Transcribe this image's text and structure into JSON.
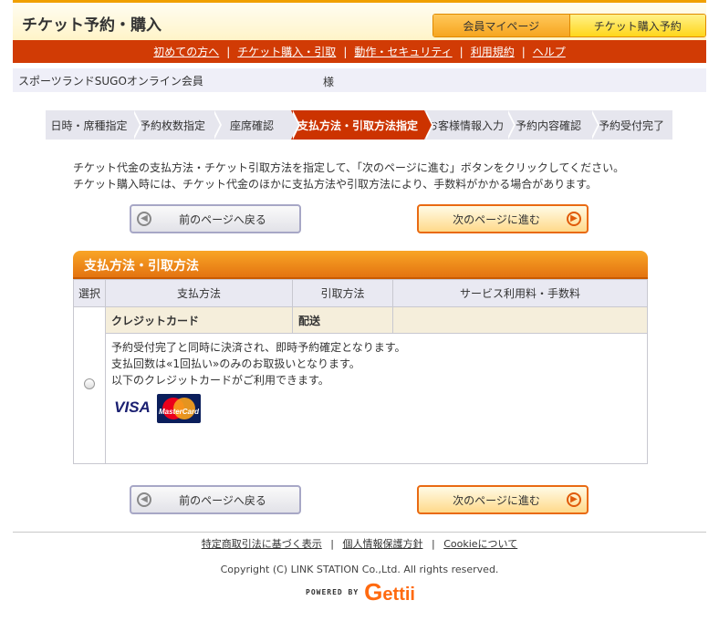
{
  "header": {
    "site_title": "チケット予約・購入",
    "tab_mypage": "会員マイページ",
    "tab_buy": "チケット購入予約"
  },
  "nav": {
    "items": [
      "初めての方へ",
      "チケット購入・引取",
      "動作・セキュリティ",
      "利用規約",
      "ヘルプ"
    ],
    "separator": "|"
  },
  "member": {
    "name": "スポーツランドSUGOオンライン会員",
    "suffix": "様"
  },
  "steps": [
    "日時・席種指定",
    "予約枚数指定",
    "座席確認",
    "支払方法・引取方法指定",
    "お客様情報入力",
    "予約内容確認",
    "予約受付完了"
  ],
  "active_step_index": 3,
  "instructions": {
    "line1": "チケット代金の支払方法・チケット引取方法を指定して、「次のページに進む」ボタンをクリックしてください。",
    "line2": "チケット購入時には、チケット代金のほかに支払方法や引取方法により、手数料がかかる場合があります。"
  },
  "buttons": {
    "back": "前のページへ戻る",
    "next": "次のページに進む"
  },
  "section": {
    "title": "支払方法・引取方法"
  },
  "table": {
    "headers": [
      "選択",
      "支払方法",
      "引取方法",
      "サービス利用料・手数料"
    ],
    "option": {
      "payment": "クレジットカード",
      "delivery": "配送",
      "fee": "",
      "desc1": "予約受付完了と同時に決済され、即時予約確定となります。",
      "desc2": "支払回数は«1回払い»のみのお取扱いとなります。",
      "desc3": "以下のクレジットカードがご利用できます。",
      "card_visa": "VISA",
      "card_master": "MasterCard"
    }
  },
  "footer": {
    "links": [
      "特定商取引法に基づく表示",
      "個人情報保護方針",
      "Cookieについて"
    ],
    "separator": "|",
    "copyright": "Copyright (C) LINK STATION Co.,Ltd. All rights reserved.",
    "powered": "POWERED BY",
    "logo_g": "G",
    "logo_rest": "ettii"
  },
  "colors": {
    "nav_red": "#d13b05",
    "active_step": "#cc3300",
    "section_orange": "#f39a1f"
  }
}
